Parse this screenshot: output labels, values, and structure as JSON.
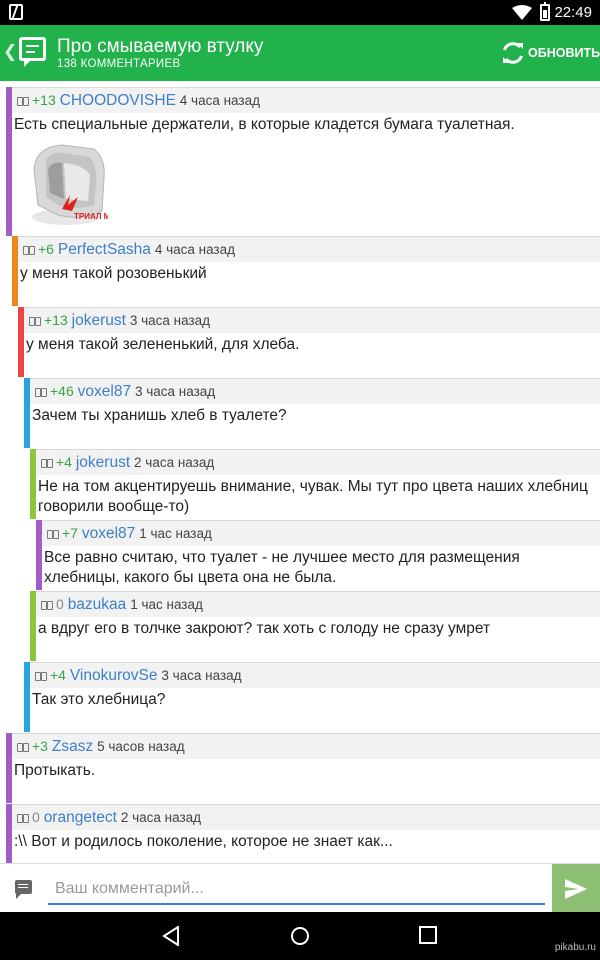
{
  "status": {
    "time": "22:49"
  },
  "appbar": {
    "title": "Про смываемую втулку",
    "subtitle": "138 КОММЕНТАРИЕВ",
    "refresh_label": "ОБНОВИТЬ"
  },
  "comments": [
    {
      "rating": "+13",
      "user": "CHOODOVISHE",
      "ago": "4 часа назад",
      "text": "Есть специальные держатели, в которые кладется бумага туалетная.",
      "bar_color": "#a05cc8",
      "has_image": true,
      "image_caption": "ТРИАЛ МАРКЕТ"
    },
    {
      "rating": "+6",
      "user": "PerfectSasha",
      "ago": "4 часа назад",
      "text": "у меня такой розовенький",
      "bar_color": "#f0861a"
    },
    {
      "rating": "+13",
      "user": "jokerust",
      "ago": "3 часа назад",
      "text": "у меня такой зелененький, для хлеба.",
      "bar_color": "#ee4444"
    },
    {
      "rating": "+46",
      "user": "voxel87",
      "ago": "3 часа назад",
      "text": "Зачем ты хранишь хлеб в туалете?",
      "bar_color": "#29a3e0"
    },
    {
      "rating": "+4",
      "user": "jokerust",
      "ago": "2 часа назад",
      "text": "Не на том акцентируешь внимание, чувак. Мы тут про цвета наших хлебниц говорили вообще-то)",
      "bar_color": "#8cc63f"
    },
    {
      "rating": "+7",
      "user": "voxel87",
      "ago": "1 час назад",
      "text": "Все равно считаю, что туалет - не лучшее место для размещения хлебницы, какого бы цвета она не была.",
      "bar_color": "#a05cc8"
    },
    {
      "rating": "0",
      "user": "bazukaa",
      "ago": "1 час назад",
      "text": "а вдруг его в толчке закроют? так хоть с голоду не сразу умрет",
      "bar_color": "#8cc63f"
    },
    {
      "rating": "+4",
      "user": "VinokurovSe",
      "ago": "3 часа назад",
      "text": "Так это хлебница?",
      "bar_color": "#29a3e0"
    },
    {
      "rating": "+3",
      "user": "Zsasz",
      "ago": "5 часов назад",
      "text": "Протыкать.",
      "bar_color": "#a05cc8"
    },
    {
      "rating": "0",
      "user": "orangetect",
      "ago": "2 часа назад",
      "text": ":\\\\ Вот и родилось поколение, которое не знает как...",
      "bar_color": "#a05cc8"
    }
  ],
  "compose": {
    "placeholder": "Ваш комментарий..."
  },
  "watermark": "pikabu.ru",
  "colors": {
    "appbar": "#21b24b",
    "link": "#3d7fc9",
    "rating": "#3aa34a",
    "send": "#8dbf74"
  }
}
